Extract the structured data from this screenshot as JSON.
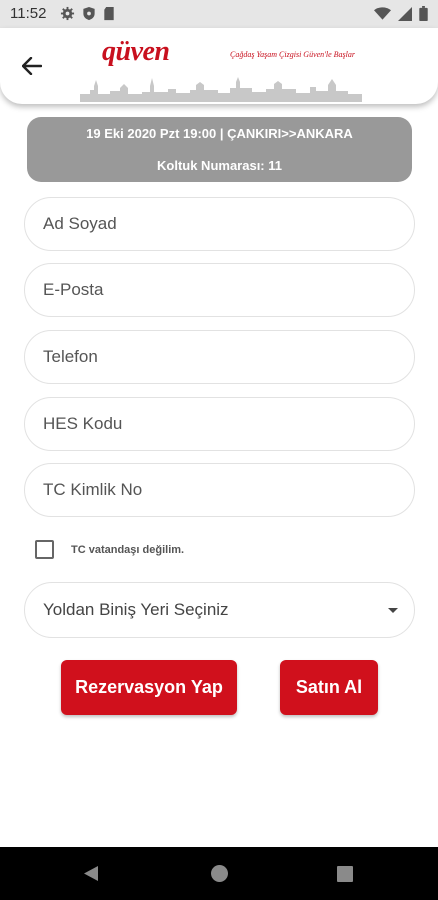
{
  "status_bar": {
    "time": "11:52"
  },
  "header": {
    "logo_text": "qüven",
    "slogan": "Çağdaş Yaşam Çizgisi Güven'le Başlar"
  },
  "trip": {
    "summary": "19 Eki 2020 Pzt 19:00 | ÇANKIRI>>ANKARA",
    "seat": "Koltuk Numarası: 11"
  },
  "form": {
    "name_placeholder": "Ad Soyad",
    "email_placeholder": "E-Posta",
    "phone_placeholder": "Telefon",
    "hes_placeholder": "HES Kodu",
    "tc_placeholder": "TC Kimlik No",
    "non_citizen_label": "TC vatandaşı değilim.",
    "non_citizen_checked": false,
    "boarding_select": "Yoldan Biniş Yeri Seçiniz"
  },
  "actions": {
    "reserve_label": "Rezervasyon Yap",
    "buy_label": "Satın Al"
  },
  "colors": {
    "brand_red": "#d0101c",
    "card_gray": "#999999"
  }
}
